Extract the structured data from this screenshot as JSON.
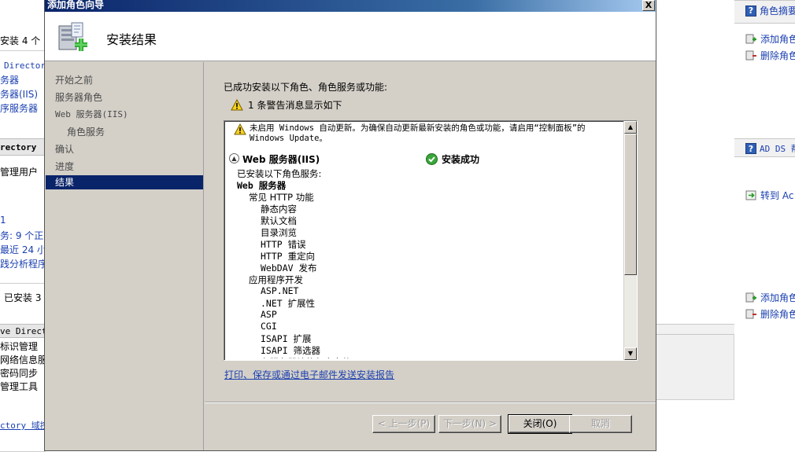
{
  "window": {
    "title": "添加角色向导",
    "close_glyph": "X"
  },
  "header": {
    "title": "安装结果"
  },
  "nav": {
    "items": [
      {
        "label": "开始之前"
      },
      {
        "label": "服务器角色"
      },
      {
        "label": "Web 服务器(IIS)"
      },
      {
        "label": "角色服务"
      },
      {
        "label": "确认"
      },
      {
        "label": "进度"
      },
      {
        "label": "结果"
      }
    ]
  },
  "content": {
    "lead": "已成功安装以下角色、角色服务或功能:",
    "warning_count": "1 条警告消息显示如下",
    "notice": "未启用 Windows 自动更新。为确保自动更新最新安装的角色或功能，请启用“控制面板”的 Windows Update。",
    "section_title": "Web 服务器(IIS)",
    "section_status": "安装成功",
    "services_intro": "已安装以下角色服务:",
    "services": [
      {
        "label": "Web 服务器",
        "level": 0,
        "bold": true
      },
      {
        "label": "常见 HTTP 功能",
        "level": 1,
        "bold": false
      },
      {
        "label": "静态内容",
        "level": 2,
        "bold": false
      },
      {
        "label": "默认文档",
        "level": 2,
        "bold": false
      },
      {
        "label": "目录浏览",
        "level": 2,
        "bold": false
      },
      {
        "label": "HTTP 错误",
        "level": 2,
        "bold": false
      },
      {
        "label": "HTTP 重定向",
        "level": 2,
        "bold": false
      },
      {
        "label": "WebDAV 发布",
        "level": 2,
        "bold": false
      },
      {
        "label": "应用程序开发",
        "level": 1,
        "bold": false
      },
      {
        "label": "ASP.NET",
        "level": 2,
        "bold": false
      },
      {
        "label": ".NET 扩展性",
        "level": 2,
        "bold": false
      },
      {
        "label": "ASP",
        "level": 2,
        "bold": false
      },
      {
        "label": "CGI",
        "level": 2,
        "bold": false
      },
      {
        "label": "ISAPI 扩展",
        "level": 2,
        "bold": false
      },
      {
        "label": "ISAPI 筛选器",
        "level": 2,
        "bold": false
      },
      {
        "label": "在服务器端的包含文件",
        "level": 2,
        "bold": false
      }
    ],
    "print_link": "打印、保存或通过电子邮件发送安装报告"
  },
  "buttons": {
    "prev": "< 上一步(P)",
    "next": "下一步(N) >",
    "close": "关闭(O)",
    "cancel": "取消"
  },
  "background": {
    "left": {
      "installed_count": "安装 4 个",
      "directory": "Directory",
      "srv1": "务器",
      "srv_iis": "务器(IIS)",
      "srv_app": "序服务器",
      "directory_header": "rectory",
      "manage_users": "管理用户",
      "one": "1",
      "svc_count": "务: 9 个正",
      "recent": "最近 24 小",
      "bpa": "践分析程序",
      "installed3": "已安装 3",
      "col_directory": "ve Directo",
      "id_mgmt": "标识管理",
      "net_info": "网络信息服",
      "pwd_sync": "密码同步",
      "mgmt_tools": "管理工具",
      "domain_link": "ctory 域控"
    },
    "right": {
      "role_summary": "角色摘要",
      "add_role": "添加角色",
      "remove_role": "删除角色",
      "adds": "AD DS 帮",
      "goto": "转到 Ac",
      "add_role2": "添加角色",
      "remove_role2": "删除角色"
    }
  },
  "colors": {
    "title_bar": "#0a246a",
    "selected_nav": "#0a246a",
    "link": "#1a3fb0",
    "dialog_face": "#d4d0c8"
  },
  "icons": {
    "header": "server-add-icon",
    "warning": "warning-icon",
    "success": "success-check-icon"
  }
}
